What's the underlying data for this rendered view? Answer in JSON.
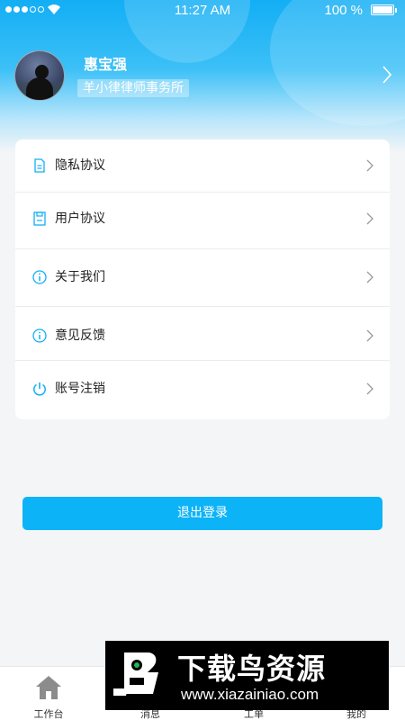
{
  "status_bar": {
    "time": "11:27 AM",
    "battery": "100 %"
  },
  "profile": {
    "name": "惠宝强",
    "firm": "羊小律律师事务所"
  },
  "menu": [
    {
      "label": "隐私协议",
      "icon": "document-icon"
    },
    {
      "label": "用户协议",
      "icon": "agreement-icon"
    },
    {
      "label": "关于我们",
      "icon": "info-icon"
    },
    {
      "label": "意见反馈",
      "icon": "info-icon"
    },
    {
      "label": "账号注销",
      "icon": "power-icon"
    }
  ],
  "logout_label": "退出登录",
  "tabs": [
    {
      "label": "工作台",
      "icon": "home-icon"
    },
    {
      "label": "消息",
      "icon": "message-icon"
    },
    {
      "label": "工单",
      "icon": "ticket-icon"
    },
    {
      "label": "我的",
      "icon": "user-icon"
    }
  ],
  "watermark": {
    "title": "下载鸟资源",
    "url": "www.xiazainiao.com"
  },
  "colors": {
    "accent": "#0cb3f7",
    "icon": "#13aef5"
  }
}
